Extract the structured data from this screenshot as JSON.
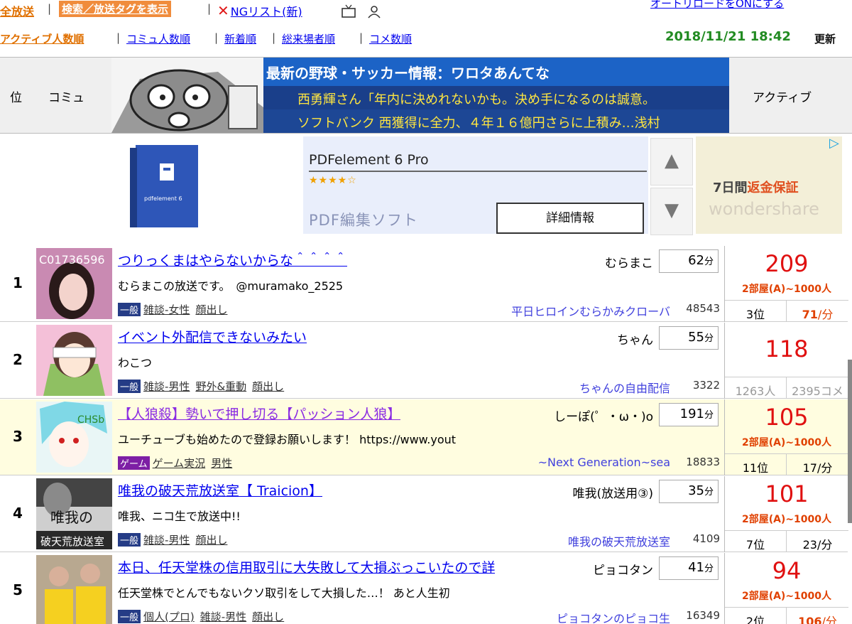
{
  "topbar": {
    "all_broadcasts": "全放送",
    "search_tags": "検索／放送タグを表示",
    "ng_list": "NGリスト(新)",
    "auto_reload": "オートリロードをONにする",
    "sep": "|"
  },
  "sort": {
    "options": [
      "アクティブ人数順",
      "コミュ人数順",
      "新着順",
      "総来場者順",
      "コメ数順"
    ],
    "datetime": "2018/11/21 18:42",
    "refresh": "更新"
  },
  "header": {
    "pos": "位",
    "community": "コミュ",
    "active": "アクティブ"
  },
  "banner": {
    "title": "最新の野球・サッカー情報：ワロタあんてな",
    "line1": "西勇輝さん「年内に決めれないかも。決め手になるのは誠意。",
    "line2": "ソフトバンク 西獲得に全力、４年１６億円さらに上積み…浅村"
  },
  "ad": {
    "product": "PDFelement 6 Pro",
    "stars": "★★★★☆",
    "category": "PDF編集ソフト",
    "button": "詳細情報",
    "guarantee_prefix": "7日間",
    "guarantee_highlight": "返金保証",
    "brand": "wondershare",
    "up": "▲",
    "down": "▼"
  },
  "colors": {
    "accent_orange": "#f08c3c",
    "count_red": "#e01010",
    "date_green": "#228b22",
    "banner_blue": "#1c63c6"
  },
  "rows": [
    {
      "rank": "1",
      "title": "つりっくまはやらないからな＾＾＾＾",
      "owner": "むらまこ",
      "minutes": "62",
      "min_unit": "分",
      "desc": "むらまこの放送です。　@muramako_2525",
      "category": "一般",
      "tags": [
        "雑談-女性",
        "顔出し"
      ],
      "community": "平日ヒロインむらかみクローバ",
      "comm_count": "48543",
      "active": "209",
      "room": "2部屋(A)~1000人",
      "sub_left": "3位",
      "sub_right_val": "71",
      "sub_right_unit": "/分"
    },
    {
      "rank": "2",
      "title": "イベント外配信できないみたい",
      "owner": "ちゃん",
      "minutes": "55",
      "min_unit": "分",
      "desc": "わこつ",
      "category": "一般",
      "tags": [
        "雑談-男性",
        "野外&重動",
        "顔出し"
      ],
      "community": "ちゃんの自由配信",
      "comm_count": "3322",
      "active": "118",
      "room": "",
      "sub_left": "1263人",
      "sub_right_val": "2395コメ",
      "sub_right_unit": ""
    },
    {
      "rank": "3",
      "title": "【人狼殺】勢いで押し切る【パッション人狼】",
      "owner": "しーぽ(゜・ω・)o",
      "minutes": "191",
      "min_unit": "分",
      "desc": "ユーチューブも始めたので登録お願いします！ https://www.yout",
      "category": "ゲーム",
      "tags": [
        "ゲーム実況",
        "男性"
      ],
      "community": "~Next Generation~sea",
      "comm_count": "18833",
      "active": "105",
      "room": "2部屋(A)~1000人",
      "sub_left": "11位",
      "sub_right_val": "17",
      "sub_right_unit": "/分"
    },
    {
      "rank": "4",
      "title": "唯我の破天荒放送室【 Traicion】",
      "owner": "唯我(放送用③)",
      "minutes": "35",
      "min_unit": "分",
      "desc": "唯我、ニコ生で放送中!!",
      "category": "一般",
      "tags": [
        "雑談-男性",
        "顔出し"
      ],
      "community": "唯我の破天荒放送室",
      "comm_count": "4109",
      "active": "101",
      "room": "2部屋(A)~1000人",
      "sub_left": "7位",
      "sub_right_val": "23",
      "sub_right_unit": "/分"
    },
    {
      "rank": "5",
      "title": "本日、任天堂株の信用取引に大失敗して大損ぶっこいたので詳",
      "owner": "ピョコタン",
      "minutes": "41",
      "min_unit": "分",
      "desc": "任天堂株でとんでもないクソ取引をして大損した…！ あと人生初",
      "category": "一般",
      "tags": [
        "個人(プロ)",
        "雑談-男性",
        "顔出し"
      ],
      "community": "ピョコタンのピョコ生",
      "comm_count": "16349",
      "active": "94",
      "room": "2部屋(A)~1000人",
      "sub_left": "2位",
      "sub_right_val": "106",
      "sub_right_unit": "/分"
    }
  ]
}
